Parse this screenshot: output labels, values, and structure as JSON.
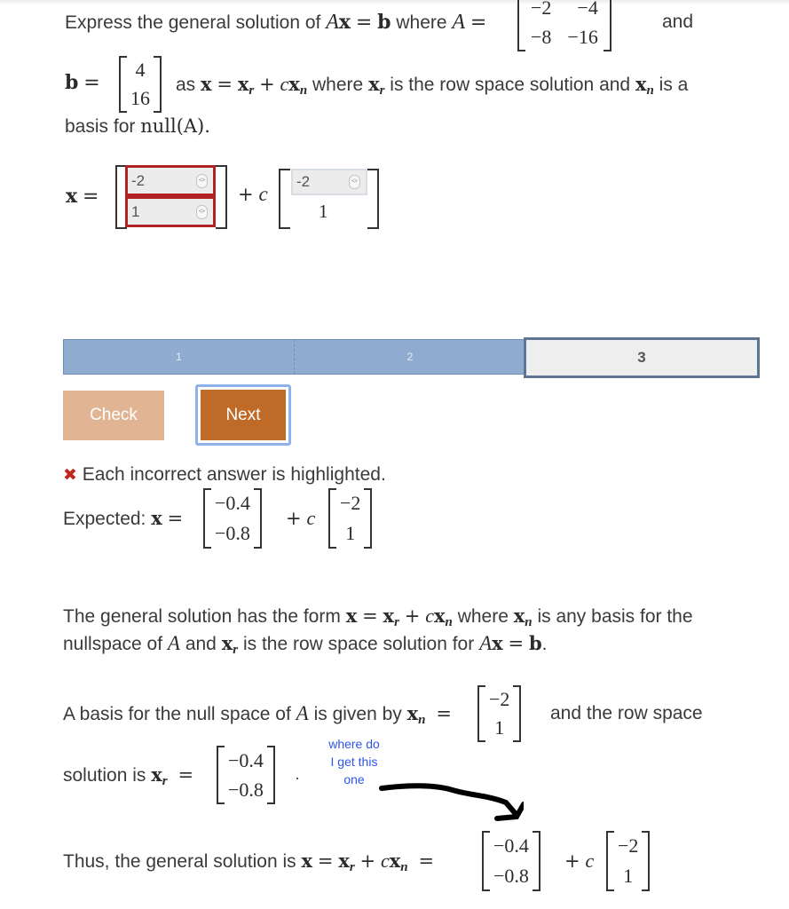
{
  "problem": {
    "intro": "Express the general solution of",
    "where_A": "where",
    "and": "and",
    "as": "as",
    "where_xr": "where",
    "row_space_text": "is the row space solution and",
    "is_a": "is a",
    "basis_for": "basis for",
    "null_A": "null(A).",
    "A_matrix": [
      [
        "−2",
        "−4"
      ],
      [
        "−8",
        "−16"
      ]
    ],
    "b_vector": [
      "4",
      "16"
    ]
  },
  "answer": {
    "x_label": "x =",
    "plus_c": "+ c",
    "xr_inputs": [
      {
        "value": "-2",
        "status": "incorrect"
      },
      {
        "value": "1",
        "status": "incorrect"
      }
    ],
    "xn_input": {
      "value": "-2"
    },
    "xn_fixed": "1"
  },
  "progress": {
    "steps": [
      {
        "label": "1",
        "state": "done"
      },
      {
        "label": "2",
        "state": "done"
      },
      {
        "label": "3",
        "state": "current"
      }
    ]
  },
  "buttons": {
    "check": "Check",
    "next": "Next"
  },
  "feedback": {
    "icon": "✖",
    "message": "Each incorrect answer is highlighted.",
    "expected_label": "Expected:",
    "expected_xr": [
      "−0.4",
      "−0.8"
    ],
    "expected_xn": [
      "−2",
      "1"
    ]
  },
  "explanation": {
    "p1_a": "The general solution has the form",
    "p1_b": "where",
    "p1_c": "is any basis for the",
    "p1_d": "nullspace of",
    "p1_e": "and",
    "p1_f": "is the row space solution for",
    "p2_a": "A basis for the null space of",
    "p2_b": "is given by",
    "p2_c": "and the row space",
    "p2_d": "solution is",
    "xn": [
      "−2",
      "1"
    ],
    "xr": [
      "−0.4",
      "−0.8"
    ],
    "p3_a": "Thus, the general solution is"
  },
  "annotation": {
    "handwritten_note": [
      "where do",
      "I get this",
      "one"
    ],
    "note_color": "#2f56e8"
  }
}
